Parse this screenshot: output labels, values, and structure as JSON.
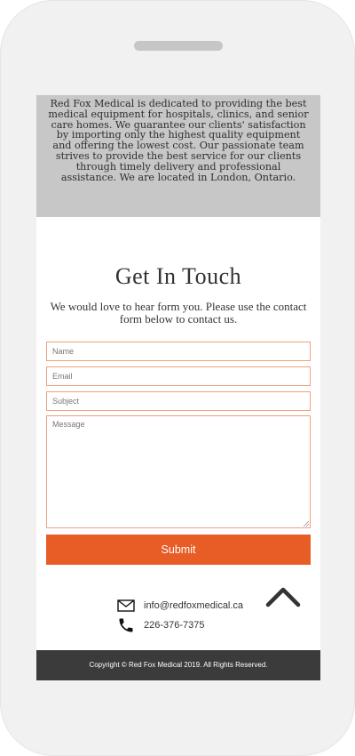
{
  "about": {
    "text": "Red Fox Medical is dedicated to providing the best medical equipment for hospitals, clinics, and senior care homes. We guarantee our clients' satisfaction by importing only the highest quality equipment and offering the lowest cost. Our passionate team strives to provide the best service for our clients through timely delivery and professional assistance. We are located in London, Ontario."
  },
  "contact_form": {
    "title": "Get In Touch",
    "intro": "We would love to hear form you. Please use the contact form below to contact us.",
    "name_placeholder": "Name",
    "email_placeholder": "Email",
    "subject_placeholder": "Subject",
    "message_placeholder": "Message",
    "submit_label": "Submit"
  },
  "contact_info": {
    "email": "info@redfoxmedical.ca",
    "phone": "226-376-7375",
    "email_icon": "envelope-icon",
    "phone_icon": "phone-icon"
  },
  "scroll_top_icon": "chevron-up-icon",
  "footer": {
    "copyright": "Copyright © Red Fox Medical 2019. All Rights Reserved."
  },
  "colors": {
    "accent": "#e85c25",
    "field_border": "#f0a080",
    "about_bg": "#c7c7c7",
    "footer_bg": "#3b3b3b"
  }
}
